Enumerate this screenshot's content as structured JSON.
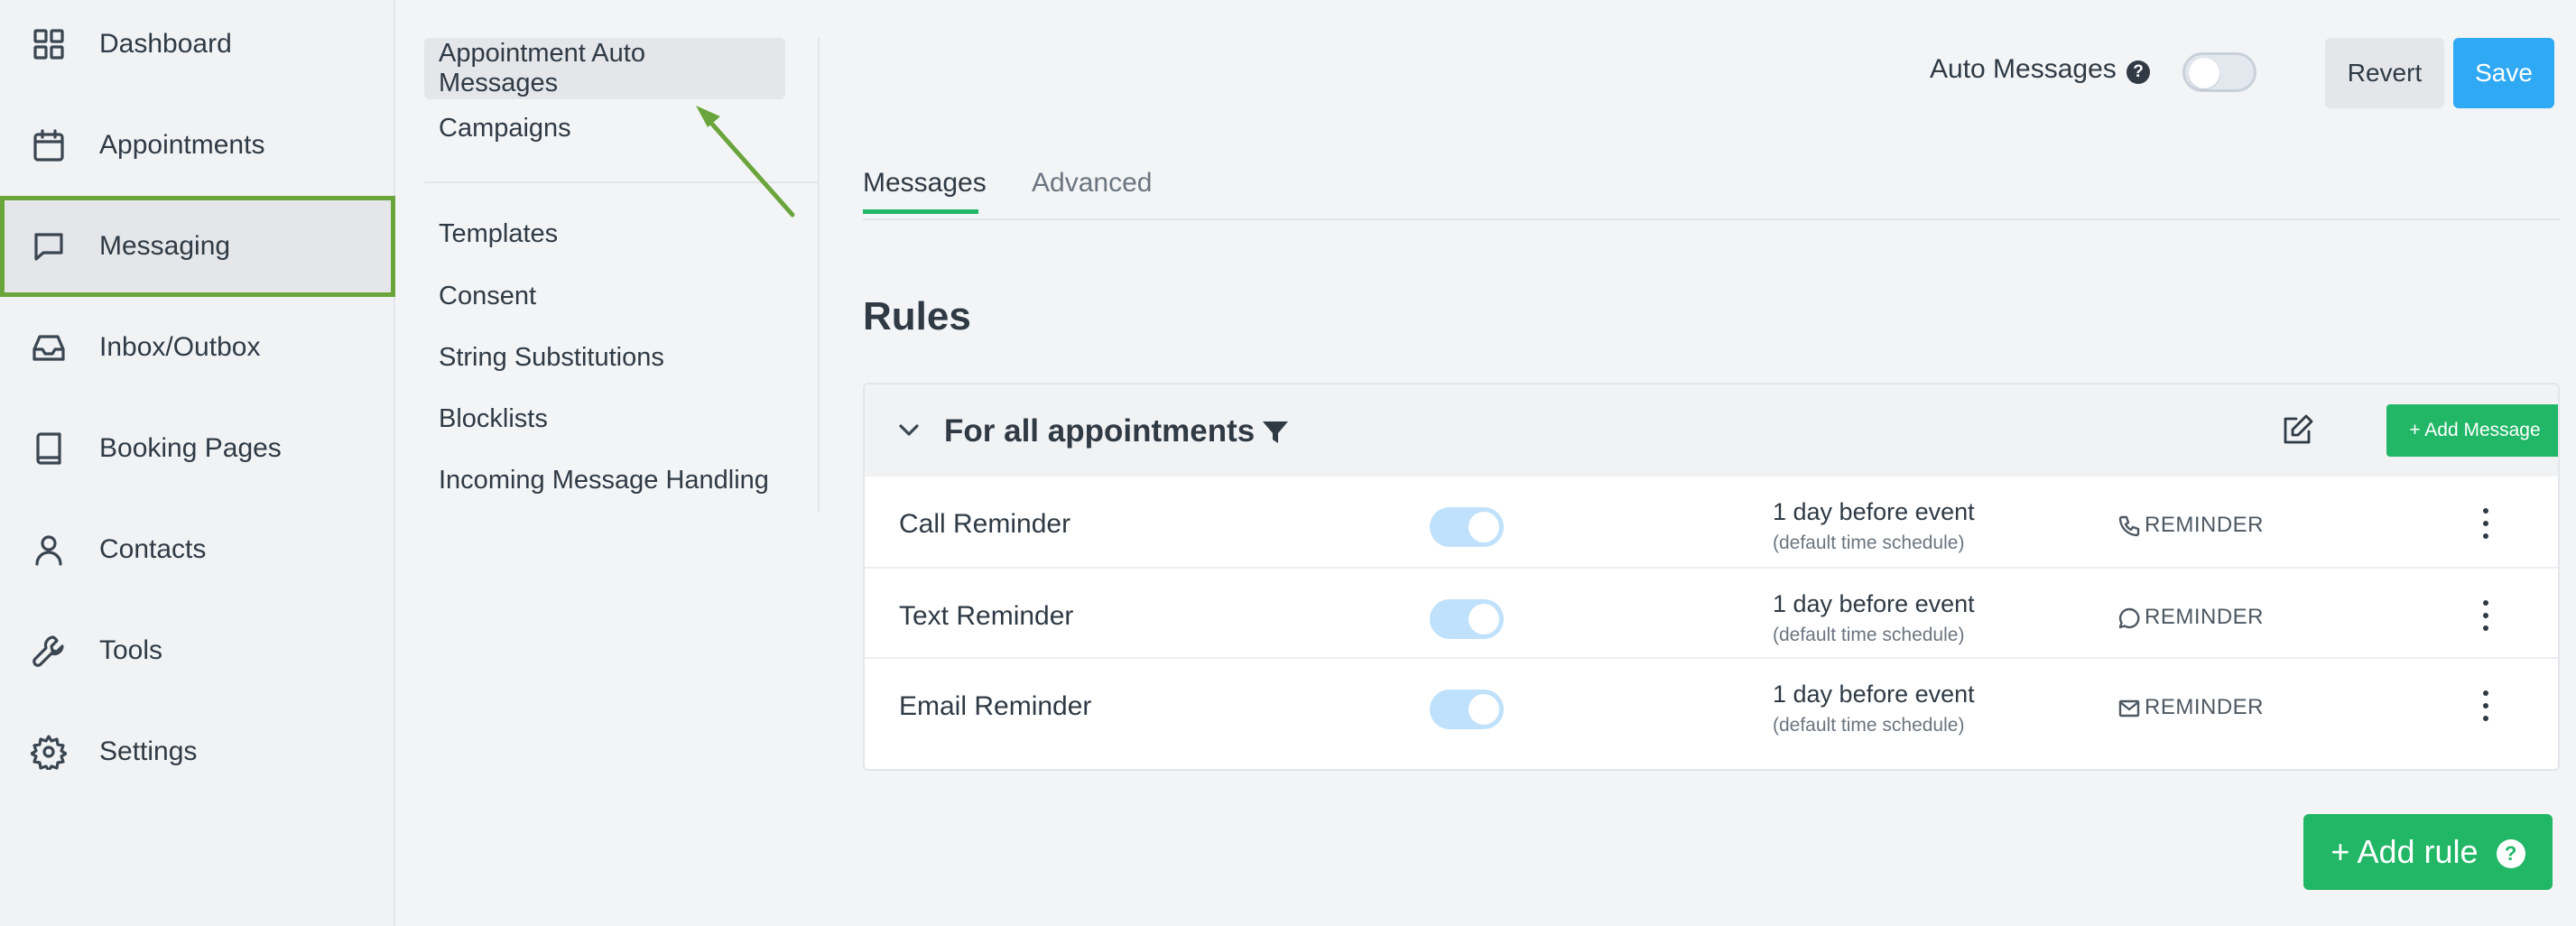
{
  "sidebar": {
    "items": [
      {
        "label": "Dashboard",
        "icon": "grid-icon"
      },
      {
        "label": "Appointments",
        "icon": "calendar-icon"
      },
      {
        "label": "Messaging",
        "icon": "chat-icon",
        "active": true
      },
      {
        "label": "Inbox/Outbox",
        "icon": "inbox-icon"
      },
      {
        "label": "Booking Pages",
        "icon": "book-icon"
      },
      {
        "label": "Contacts",
        "icon": "user-icon"
      },
      {
        "label": "Tools",
        "icon": "wrench-icon"
      },
      {
        "label": "Settings",
        "icon": "gear-icon"
      }
    ]
  },
  "subnav": {
    "items": [
      {
        "label": "Appointment Auto Messages",
        "active": true
      },
      {
        "label": "Campaigns"
      },
      {
        "label": "Templates"
      },
      {
        "label": "Consent"
      },
      {
        "label": "String Substitutions"
      },
      {
        "label": "Blocklists"
      },
      {
        "label": "Incoming Message Handling"
      }
    ]
  },
  "header": {
    "auto_messages_label": "Auto Messages",
    "help_glyph": "?",
    "auto_messages_enabled": false,
    "revert_label": "Revert",
    "save_label": "Save"
  },
  "tabs": [
    {
      "label": "Messages",
      "active": true
    },
    {
      "label": "Advanced"
    }
  ],
  "rules_title": "Rules",
  "rule_group": {
    "title": "For all appointments",
    "add_message_label": "+ Add Message",
    "messages": [
      {
        "name": "Call Reminder",
        "enabled": true,
        "when": "1 day before event",
        "schedule": "(default time schedule)",
        "type": "REMINDER",
        "type_icon": "phone-icon"
      },
      {
        "name": "Text Reminder",
        "enabled": true,
        "when": "1 day before event",
        "schedule": "(default time schedule)",
        "type": "REMINDER",
        "type_icon": "chat-bubble-icon"
      },
      {
        "name": "Email Reminder",
        "enabled": true,
        "when": "1 day before event",
        "schedule": "(default time schedule)",
        "type": "REMINDER",
        "type_icon": "envelope-icon"
      }
    ]
  },
  "add_rule_label": "+ Add rule",
  "colors": {
    "accent_green": "#21b766",
    "save_blue": "#30a9f4",
    "highlight_border": "#6aa53c"
  }
}
